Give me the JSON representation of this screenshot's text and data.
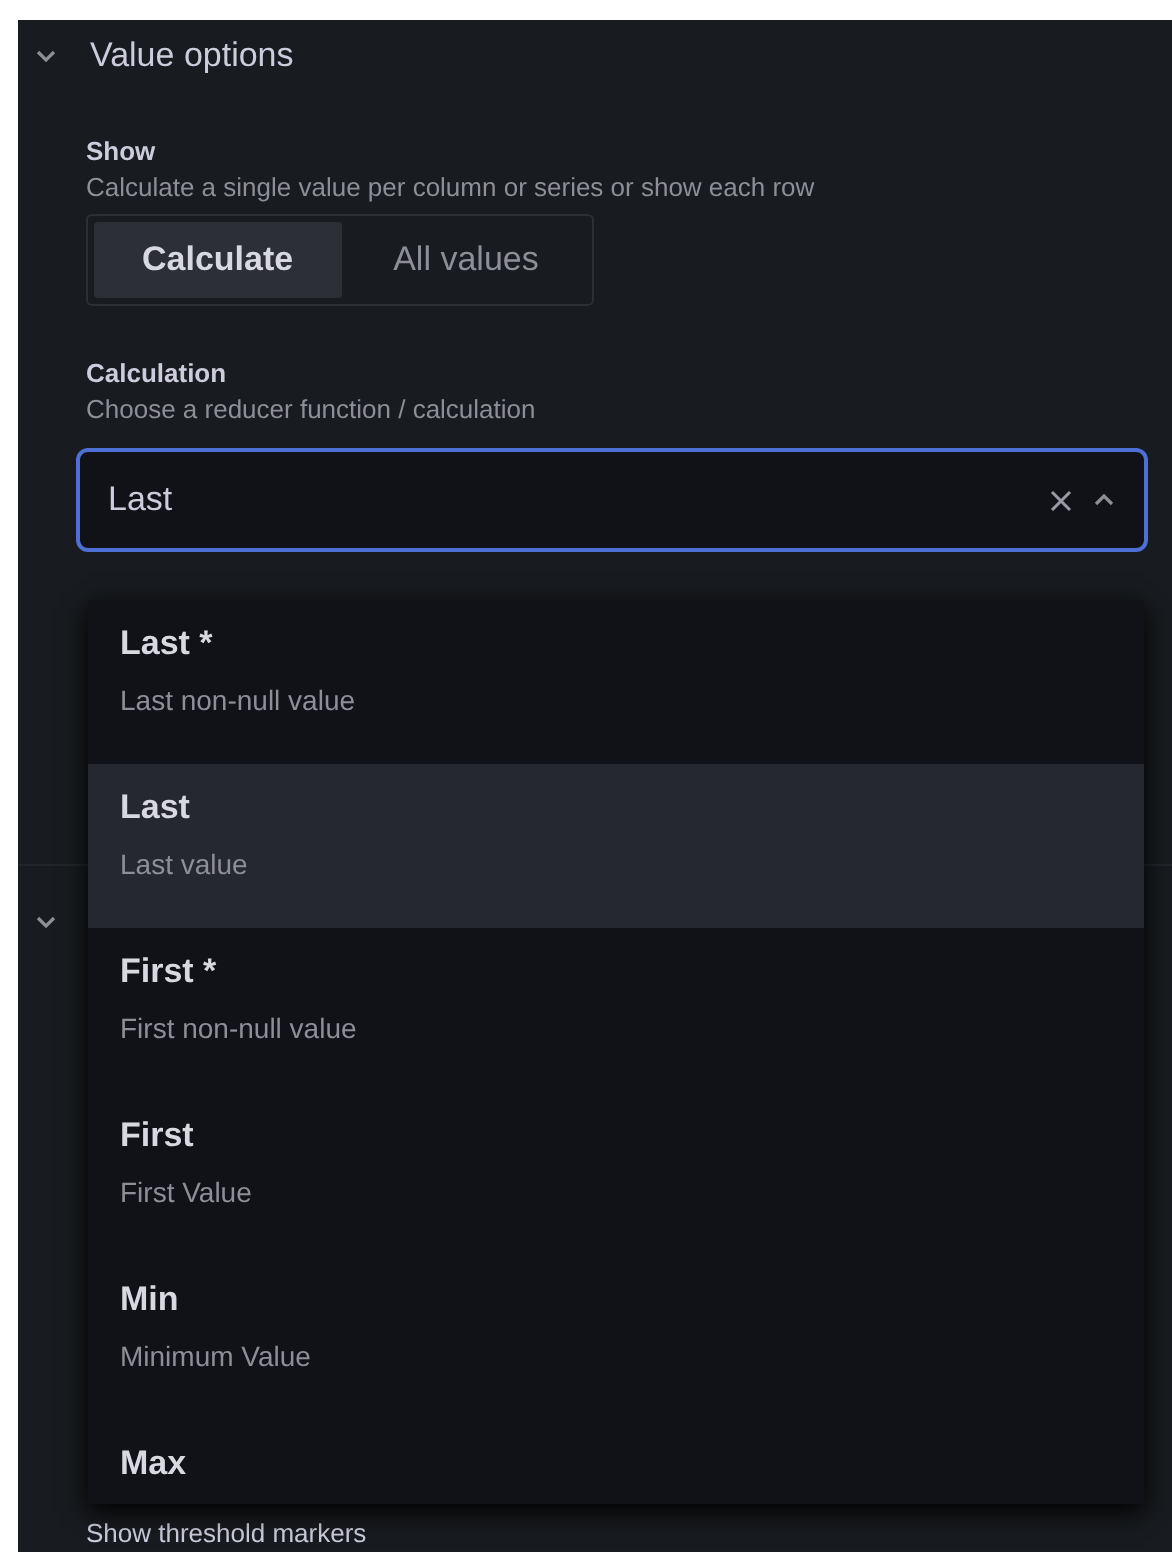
{
  "section": {
    "title": "Value options",
    "expanded": true
  },
  "show": {
    "label": "Show",
    "description": "Calculate a single value per column or series or show each row",
    "options": [
      {
        "label": "Calculate",
        "selected": true
      },
      {
        "label": "All values",
        "selected": false
      }
    ]
  },
  "calculation": {
    "label": "Calculation",
    "description": "Choose a reducer function / calculation",
    "value": "Last",
    "open": true,
    "options": [
      {
        "label": "Last *",
        "description": "Last non-null value",
        "selected": false
      },
      {
        "label": "Last",
        "description": "Last value",
        "selected": true
      },
      {
        "label": "First *",
        "description": "First non-null value",
        "selected": false
      },
      {
        "label": "First",
        "description": "First Value",
        "selected": false
      },
      {
        "label": "Min",
        "description": "Minimum Value",
        "selected": false
      },
      {
        "label": "Max",
        "selected": false
      }
    ]
  },
  "next_section": {
    "expanded": true
  },
  "threshold_markers": {
    "label": "Show threshold markers"
  }
}
